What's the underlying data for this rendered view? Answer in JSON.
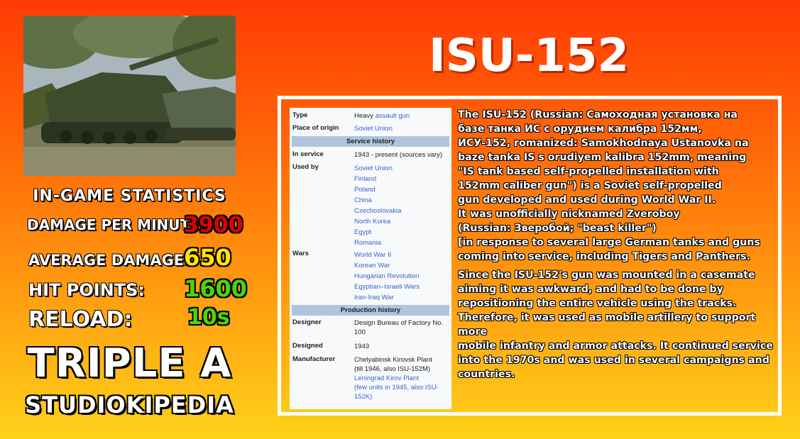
{
  "title": "ISU-152",
  "photo": {
    "alt": "tank-photo"
  },
  "stats": {
    "heading": "IN-GAME STATISTICS",
    "items": [
      {
        "label": "DAMAGE PER MINUTE:",
        "value": "3900",
        "color": "#e00000"
      },
      {
        "label": "AVERAGE DAMAGE:",
        "value": "650",
        "color": "#ffe400"
      },
      {
        "label": "HIT POINTS:",
        "value": "1600",
        "color": "#4cd600"
      },
      {
        "label": "RELOAD:",
        "value": "10s",
        "color": "#4cd600"
      }
    ]
  },
  "brand": {
    "line1": "TRIPLE A",
    "line2": "STUDIOKIPEDIA"
  },
  "infobox": {
    "type_label": "Type",
    "type_value_prefix": "Heavy ",
    "type_value_link": "assault gun",
    "origin_label": "Place of origin",
    "origin_value": "Soviet Union",
    "service_heading": "Service history",
    "in_service_label": "In service",
    "in_service_value": "1943 - present (sources vary)",
    "used_by_label": "Used by",
    "used_by": [
      "Soviet Union",
      "Finland",
      "Poland",
      "China",
      "Czechoslovakia",
      "North Korea",
      "Egypt",
      "Romania"
    ],
    "wars_label": "Wars",
    "wars": [
      "World War II",
      "Korean War",
      "Hungarian Revolution",
      "Egyptian–Israeli Wars",
      "Iran-Iraq War"
    ],
    "production_heading": "Production history",
    "designer_label": "Designer",
    "designer_value": "Design Bureau of Factory No. 100",
    "designed_label": "Designed",
    "designed_value": "1943",
    "manufacturer_label": "Manufacturer",
    "manufacturer_1": "Chelyabinsk Kirovsk Plant",
    "manufacturer_1_note": "(till 1946, also ISU-152M)",
    "manufacturer_2": "Leningrad Kirov Plant",
    "manufacturer_2_note": "(few units in 1945, also ISU-152K)"
  },
  "description": {
    "p1": [
      "The ISU-152 (Russian: Самоходная установка на",
      "базе танка ИС с орудием калибра 152мм,",
      "ИСУ-152, romanized: Samokhodnaya Ustanovka na",
      "baze tanka IS s orudiyem kalibra 152mm, meaning",
      "\"IS tank based self-propelled installation with",
      "152mm caliber gun\") is a Soviet self-propelled",
      "gun developed and used during World War II.",
      "It was unofficially nicknamed Zveroboy",
      "(Russian: Зверобой; \"beast killer\")",
      "[in response to several large German tanks and guns",
      "coming into service, including Tigers and Panthers."
    ],
    "p2": [
      "Since the ISU-152's gun was mounted in a casemate",
      "aiming it was awkward, and had to be done by",
      "repositioning the entire vehicle using the tracks.",
      "Therefore, it was used as mobile artillery to support more",
      "mobile infantry and armor attacks. It continued service",
      "into the 1970s and was used in several campaigns and",
      "countries."
    ]
  }
}
